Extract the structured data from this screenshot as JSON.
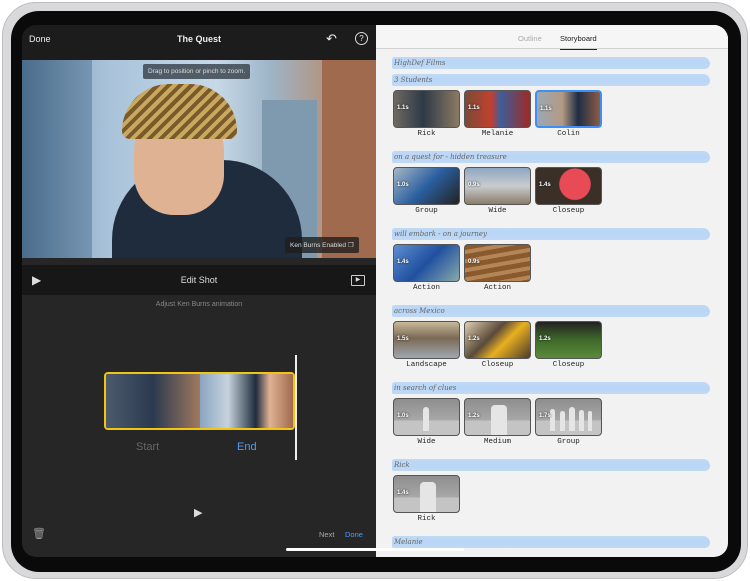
{
  "left": {
    "done_label": "Done",
    "title": "The Quest",
    "undo_icon": "↶",
    "help_icon": "?",
    "tooltip": "Drag to position or pinch to zoom.",
    "ken_burns_badge": "Ken Burns Enabled",
    "edit_shot_label": "Edit Shot",
    "subtitle": "Adjust Ken Burns animation",
    "start_label": "Start",
    "end_label": "End",
    "next_label": "Next",
    "done2_label": "Done",
    "accent": "#4a9df5",
    "selection_color": "#f2c511"
  },
  "right": {
    "tabs": [
      {
        "label": "Outline"
      },
      {
        "label": "Storyboard"
      }
    ],
    "heading": "HighDef Films",
    "sections": [
      {
        "title": "3 Students",
        "clips": [
          {
            "dur": "1.1s",
            "label": "Rick",
            "bg": "linear-gradient(90deg,#6d6a62,#2e3947 45%,#8b7a63)"
          },
          {
            "dur": "1.1s",
            "label": "Melanie",
            "bg": "linear-gradient(90deg,#7a4a38,#c24030 40%,#3e5d9a 55%,#a02a22)"
          },
          {
            "dur": "1.1s",
            "label": "Colin",
            "bg": "linear-gradient(90deg,#9aa8b5,#b49a82 40%,#1e2d44 65%,#8c5c45)",
            "selected": true
          }
        ]
      },
      {
        "title": "on a quest for - hidden treasure",
        "clips": [
          {
            "dur": "1.0s",
            "label": "Group",
            "bg": "linear-gradient(135deg,#a5b7c6,#2b5fa0 50%,#222)"
          },
          {
            "dur": "0.9s",
            "label": "Wide",
            "bg": "linear-gradient(180deg,#8fa7c2,#c8ccd0 50%,#8b7d6b)"
          },
          {
            "dur": "1.4s",
            "label": "Closeup",
            "bg": "radial-gradient(circle at 60% 45%,#e84a56 35%,#3a3028 37%)"
          }
        ]
      },
      {
        "title": "will embark - on a journey",
        "clips": [
          {
            "dur": "1.4s",
            "label": "Action",
            "bg": "linear-gradient(135deg,#5d8fd0,#2050a0 50%,#8aa)"
          },
          {
            "dur": "0.9s",
            "label": "Action",
            "bg": "repeating-linear-gradient(170deg,#8a5a2e 0 5px,#b58655 5px 9px)"
          }
        ]
      },
      {
        "title": "across Mexico",
        "clips": [
          {
            "dur": "1.5s",
            "label": "Landscape",
            "bg": "linear-gradient(180deg,#c8b99a,#7a6a55 45%,#9fa7ae)"
          },
          {
            "dur": "1.2s",
            "label": "Closeup",
            "bg": "linear-gradient(135deg,#e0cfae,#5a4a3a 40%,#e8b020 60%,#4a3a2a)"
          },
          {
            "dur": "1.2s",
            "label": "Closeup",
            "bg": "linear-gradient(180deg,#222,#3f6a2a 50%,#5a8a3a)"
          }
        ]
      },
      {
        "title": "in search of clues",
        "clips": [
          {
            "dur": "1.0s",
            "label": "Wide",
            "bg": "linear-gradient(180deg,#8e8e8e,#a8a8a8 60%,#c4c4c4 60%)",
            "figures": "wide"
          },
          {
            "dur": "1.2s",
            "label": "Medium",
            "bg": "linear-gradient(180deg,#8e8e8e,#a8a8a8 60%,#c4c4c4 60%)",
            "figures": "medium"
          },
          {
            "dur": "1.7s",
            "label": "Group",
            "bg": "linear-gradient(180deg,#8e8e8e,#a8a8a8 60%,#c4c4c4 60%)",
            "figures": "group"
          }
        ]
      },
      {
        "title": "Rick",
        "clips": [
          {
            "dur": "1.4s",
            "label": "Rick",
            "bg": "linear-gradient(180deg,#8e8e8e,#a8a8a8 60%,#c4c4c4 60%)",
            "figures": "medium"
          }
        ]
      },
      {
        "title": "Melanie",
        "clips": []
      }
    ]
  }
}
